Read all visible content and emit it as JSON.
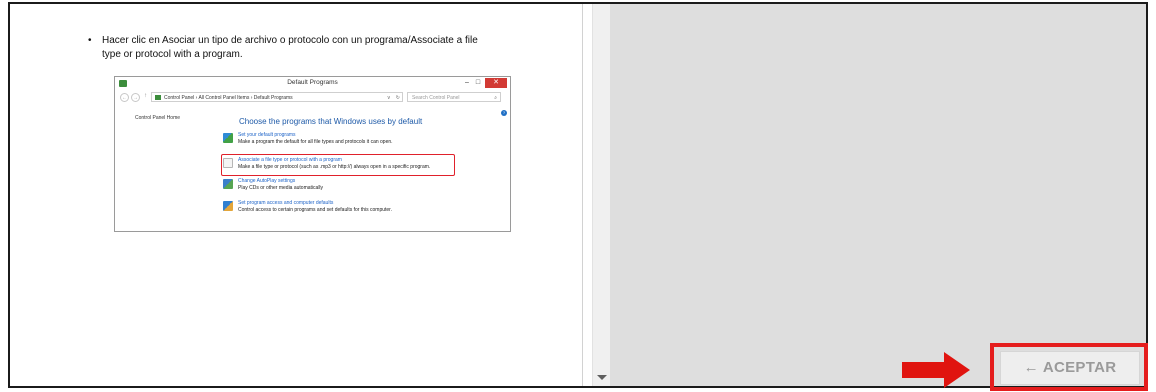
{
  "document": {
    "bullet": "•",
    "instruction_line1": "Hacer clic en Asociar un tipo de archivo o protocolo con un programa/Associate a file",
    "instruction_line2": "type or protocol with a program."
  },
  "window": {
    "title": "Default Programs",
    "minimize": "–",
    "maximize": "□",
    "close": "✕",
    "nav_back": "←",
    "nav_forward": "→",
    "nav_up": "↑",
    "address": "Control Panel › All Control Panel Items › Default Programs",
    "address_dropdown": "v",
    "address_refresh": "↻",
    "search_placeholder": "Search Control Panel",
    "search_icon": "⌕",
    "help": "?",
    "sidebar_home": "Control Panel Home",
    "heading": "Choose the programs that Windows uses by default",
    "options": [
      {
        "link": "Set your default programs",
        "desc": "Make a program the default for all file types and protocols it can open.",
        "icon": "default-programs-icon"
      },
      {
        "link": "Associate a file type or protocol with a program",
        "desc": "Make a file type or protocol (such as .mp3 or http://) always open in a specific program.",
        "icon": "file-association-icon"
      },
      {
        "link": "Change AutoPlay settings",
        "desc": "Play CDs or other media automatically",
        "icon": "autoplay-icon"
      },
      {
        "link": "Set program access and computer defaults",
        "desc": "Control access to certain programs and set defaults for this computer.",
        "icon": "program-access-icon"
      }
    ]
  },
  "action": {
    "accept_label": "← ACEPTAR"
  },
  "colors": {
    "highlight_red": "#e51d1d",
    "arrow_red": "#e0140f",
    "right_pane_bg": "#dedede",
    "link_blue": "#1e64c8"
  }
}
